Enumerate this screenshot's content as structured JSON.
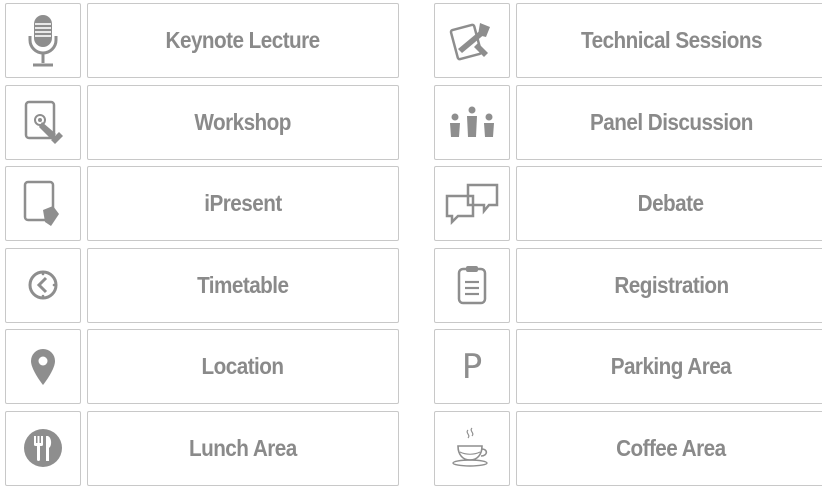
{
  "left_column": [
    {
      "icon": "microphone-icon",
      "label": "Keynote Lecture"
    },
    {
      "icon": "tablet-touch-icon",
      "label": "Workshop"
    },
    {
      "icon": "tablet-hand-icon",
      "label": "iPresent"
    },
    {
      "icon": "clock-icon",
      "label": "Timetable"
    },
    {
      "icon": "map-pin-icon",
      "label": "Location"
    },
    {
      "icon": "fork-knife-icon",
      "label": "Lunch Area"
    }
  ],
  "right_column": [
    {
      "icon": "tools-icon",
      "label": "Technical Sessions"
    },
    {
      "icon": "people-icon",
      "label": "Panel Discussion"
    },
    {
      "icon": "chat-bubbles-icon",
      "label": "Debate"
    },
    {
      "icon": "clipboard-icon",
      "label": "Registration"
    },
    {
      "icon": "parking-icon",
      "label": "Parking Area",
      "glyph": "P"
    },
    {
      "icon": "coffee-cup-icon",
      "label": "Coffee Area"
    }
  ],
  "colors": {
    "icon": "#8e8e8e",
    "text": "#8a8a8a",
    "border": "#c8c8c8"
  }
}
